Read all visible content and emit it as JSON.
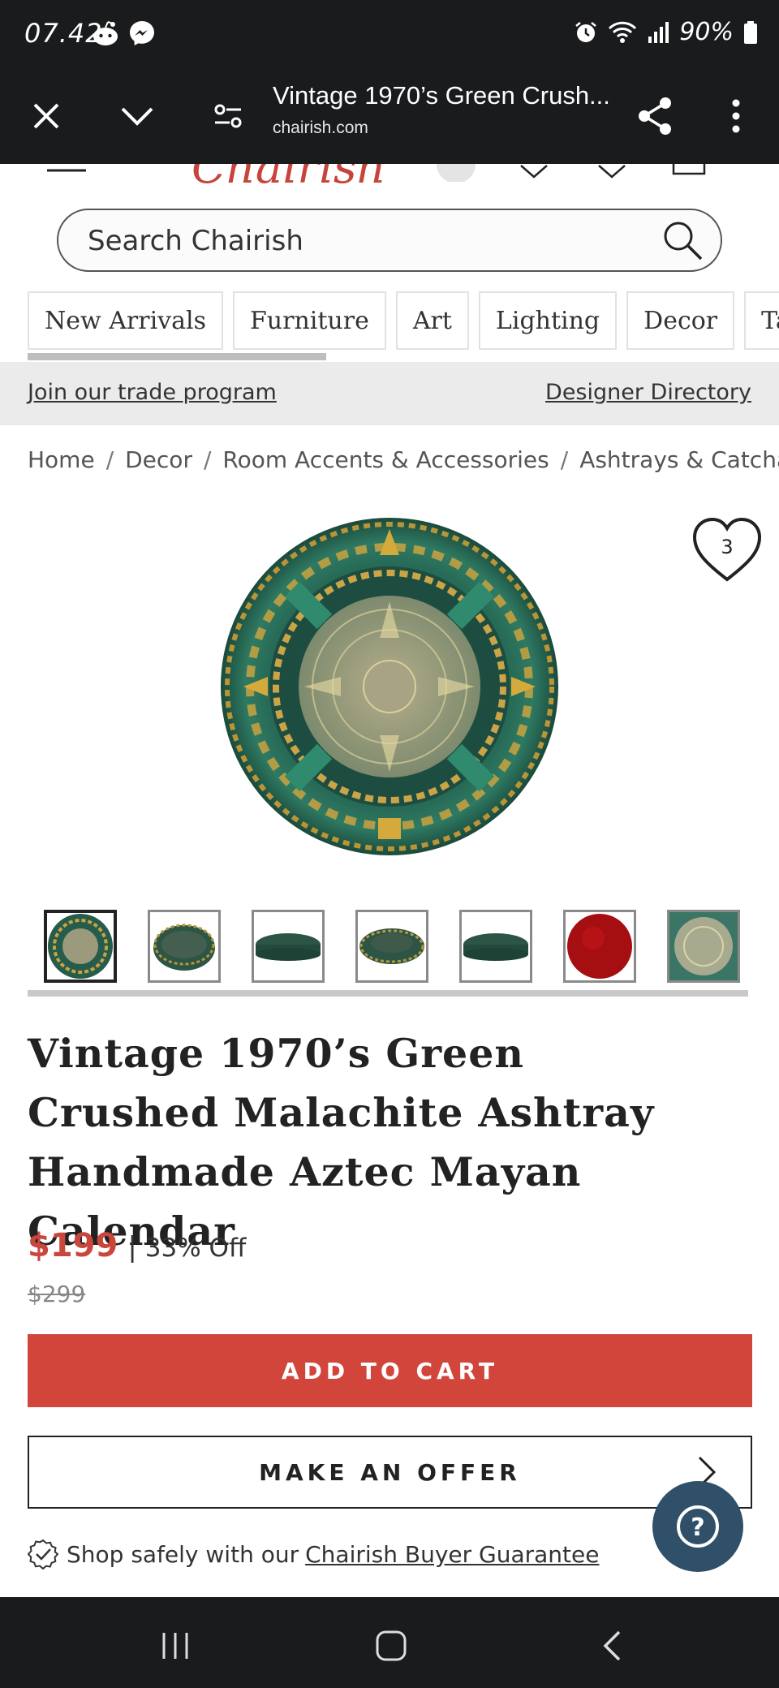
{
  "status_bar": {
    "time": "07.42",
    "battery": "90%",
    "icons": [
      "reddit-icon",
      "messenger-icon",
      "alarm-icon",
      "wifi-icon",
      "signal-icon",
      "battery-icon"
    ]
  },
  "browser": {
    "page_title": "Vintage 1970’s Green Crush...",
    "url": "chairish.com",
    "icons": [
      "close-icon",
      "chevron-down-icon",
      "site-settings-icon",
      "share-icon",
      "more-vert-icon"
    ]
  },
  "site": {
    "logo": "Chairish",
    "search_placeholder": "Search Chairish",
    "categories": [
      "New Arrivals",
      "Furniture",
      "Art",
      "Lighting",
      "Decor",
      "Ta"
    ],
    "trade_link": "Join our trade program",
    "directory_link": "Designer Directory",
    "breadcrumb": [
      "Home",
      "Decor",
      "Room Accents & Accessories",
      "Ashtrays & Catchalls"
    ],
    "breadcrumb_separator": "/"
  },
  "product": {
    "favorite_count": "3",
    "title": "Vintage 1970’s Green Crushed Malachite Ashtray Handmade Aztec Mayan Calendar",
    "price": "$199",
    "price_separator": "|",
    "discount": "33% Off",
    "original_price": "$299",
    "add_to_cart": "ADD TO CART",
    "make_offer": "MAKE AN OFFER",
    "guarantee_text": "Shop safely with our",
    "guarantee_link": "Chairish Buyer Guarantee",
    "help_icon": "?"
  },
  "colors": {
    "accent_red": "#d1453b",
    "price_red": "#c9463d",
    "help_blue": "#2f5068",
    "dark_bar": "#1a1b1d"
  }
}
